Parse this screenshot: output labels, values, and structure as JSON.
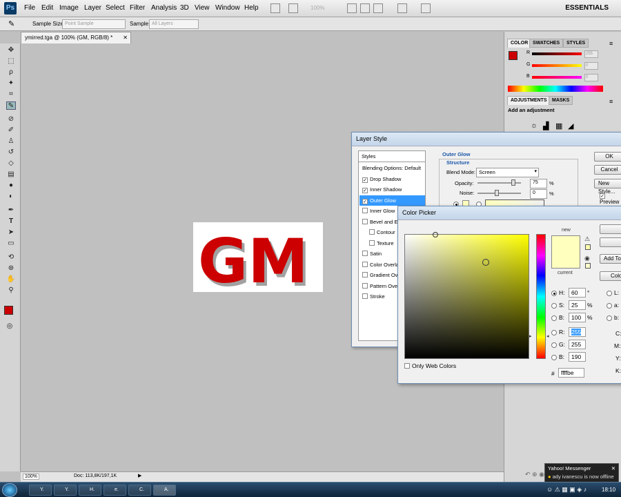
{
  "menubar": {
    "logo": "Ps",
    "items": [
      "File",
      "Edit",
      "Image",
      "Layer",
      "Select",
      "Filter",
      "Analysis",
      "3D",
      "View",
      "Window",
      "Help"
    ],
    "zoom": "100%",
    "workspace": "ESSENTIALS"
  },
  "options_bar": {
    "sample_size_label": "Sample Size:",
    "sample_size_value": "Point Sample",
    "sample_label": "Sample:",
    "sample_value": "All Layers"
  },
  "document": {
    "tab_title": "ymirred.tga @ 100% (GM, RGB/8) *",
    "image_text": "GM",
    "status_zoom": "100%",
    "status_doc": "Doc: 113,8K/197,1K"
  },
  "colors": {
    "foreground": "#cc0000",
    "background": "#ffffff",
    "accent": "#3399ff",
    "new_color": "#ffffbe",
    "current_color": "#ffffbe"
  },
  "panels": {
    "tabs": [
      "COLOR",
      "SWATCHES",
      "STYLES"
    ],
    "r_label": "R",
    "g_label": "G",
    "b_label": "B",
    "r_value": "255",
    "g_value": "0",
    "b_value": "0",
    "adjust_tabs": [
      "ADJUSTMENTS",
      "MASKS"
    ],
    "adjust_label": "Add an adjustment"
  },
  "layer_style": {
    "title": "Layer Style",
    "styles_header": "Styles",
    "items": [
      {
        "label": "Blending Options: Default",
        "check": false,
        "sub": false,
        "box": false
      },
      {
        "label": "Drop Shadow",
        "check": true,
        "sub": false,
        "box": true
      },
      {
        "label": "Inner Shadow",
        "check": true,
        "sub": false,
        "box": true
      },
      {
        "label": "Outer Glow",
        "check": true,
        "sub": false,
        "box": true
      },
      {
        "label": "Inner Glow",
        "check": false,
        "sub": false,
        "box": true
      },
      {
        "label": "Bevel and Emboss",
        "check": false,
        "sub": false,
        "box": true
      },
      {
        "label": "Contour",
        "check": false,
        "sub": true,
        "box": true
      },
      {
        "label": "Texture",
        "check": false,
        "sub": true,
        "box": true
      },
      {
        "label": "Satin",
        "check": false,
        "sub": false,
        "box": true
      },
      {
        "label": "Color Overlay",
        "check": false,
        "sub": false,
        "box": true
      },
      {
        "label": "Gradient Overlay",
        "check": false,
        "sub": false,
        "box": true
      },
      {
        "label": "Pattern Overlay",
        "check": false,
        "sub": false,
        "box": true
      },
      {
        "label": "Stroke",
        "check": false,
        "sub": false,
        "box": true
      }
    ],
    "section_title": "Outer Glow",
    "structure_label": "Structure",
    "blend_mode_label": "Blend Mode:",
    "blend_mode_value": "Screen",
    "opacity_label": "Opacity:",
    "opacity_value": "75",
    "noise_label": "Noise:",
    "noise_value": "0",
    "percent": "%",
    "ok": "OK",
    "cancel": "Cancel",
    "new_style": "New Style...",
    "preview": "Preview"
  },
  "color_picker": {
    "title": "Color Picker",
    "new_label": "new",
    "current_label": "current",
    "h_label": "H:",
    "h_value": "60",
    "h_unit": "°",
    "s_label": "S:",
    "s_value": "25",
    "s_unit": "%",
    "b_label": "B:",
    "b_value": "100",
    "b_unit": "%",
    "r_label": "R:",
    "r_value": "255",
    "g_label": "G:",
    "g_value": "255",
    "bb_label": "B:",
    "bb_value": "190",
    "l_label": "L:",
    "a_label": "a:",
    "b2_label": "b:",
    "c_label": "C:",
    "m_label": "M:",
    "y_label": "Y:",
    "k_label": "K:",
    "hex_label": "#",
    "hex_value": "ffffbe",
    "only_web": "Only Web Colors",
    "add_to": "Add To",
    "color_lib": "Color"
  },
  "taskbar": {
    "tasks": [
      "Y.",
      "Y.",
      "H.",
      "e.",
      "C.",
      "A."
    ],
    "clock": "18:10"
  },
  "yahoo": {
    "title": "Yahoo! Messenger",
    "message": "ady ivanescu is now offline"
  }
}
